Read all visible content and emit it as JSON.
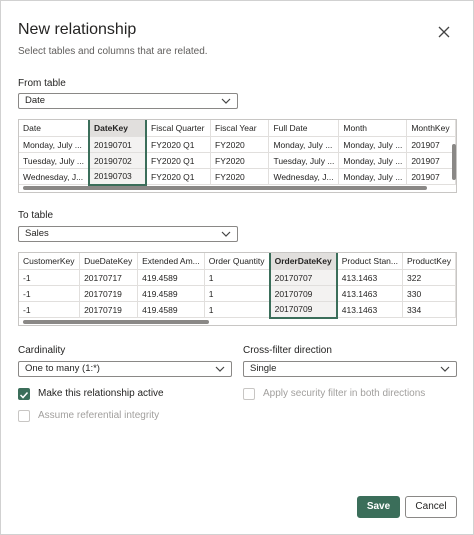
{
  "dialog": {
    "title": "New relationship",
    "subtitle": "Select tables and columns that are related.",
    "close_icon": "close-icon"
  },
  "from": {
    "label": "From table",
    "table": "Date",
    "columns": [
      "Date",
      "DateKey",
      "Fiscal Quarter",
      "Fiscal Year",
      "Full Date",
      "Month",
      "MonthKey"
    ],
    "selected_column": 1,
    "rows": [
      [
        "Monday, July ...",
        "20190701",
        "FY2020 Q1",
        "FY2020",
        "Monday, July ...",
        "Monday, July ...",
        "201907"
      ],
      [
        "Tuesday, July ...",
        "20190702",
        "FY2020 Q1",
        "FY2020",
        "Tuesday, July ...",
        "Monday, July ...",
        "201907"
      ],
      [
        "Wednesday, J...",
        "20190703",
        "FY2020 Q1",
        "FY2020",
        "Wednesday, J...",
        "Monday, July ...",
        "201907"
      ]
    ]
  },
  "to": {
    "label": "To table",
    "table": "Sales",
    "columns": [
      "CustomerKey",
      "DueDateKey",
      "Extended Am...",
      "Order Quantity",
      "OrderDateKey",
      "Product Stan...",
      "ProductKey"
    ],
    "selected_column": 4,
    "rows": [
      [
        "-1",
        "20170717",
        "419.4589",
        "1",
        "20170707",
        "413.1463",
        "322"
      ],
      [
        "-1",
        "20170719",
        "419.4589",
        "1",
        "20170709",
        "413.1463",
        "330"
      ],
      [
        "-1",
        "20170719",
        "419.4589",
        "1",
        "20170709",
        "413.1463",
        "334"
      ]
    ]
  },
  "cardinality": {
    "label": "Cardinality",
    "value": "One to many (1:*)"
  },
  "crossfilter": {
    "label": "Cross-filter direction",
    "value": "Single"
  },
  "options": {
    "active_label": "Make this relationship active",
    "active_checked": true,
    "security_label": "Apply security filter in both directions",
    "security_checked": false,
    "integrity_label": "Assume referential integrity",
    "integrity_checked": false
  },
  "buttons": {
    "save": "Save",
    "cancel": "Cancel"
  },
  "colors": {
    "accent": "#3b6e5a",
    "selected_header": "#e1dfdd"
  }
}
